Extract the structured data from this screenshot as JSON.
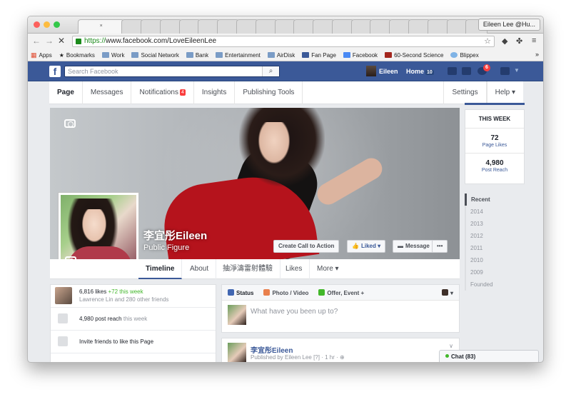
{
  "browser": {
    "active_tab": "×",
    "profile": "Eileen Lee @Hu...",
    "url_https": "https://",
    "url_rest": "www.facebook.com/LoveEileenLee",
    "bookmarks": [
      "Apps",
      "Bookmarks",
      "Work",
      "Social Network",
      "Bank",
      "Entertainment",
      "AirDisk",
      "Fan Page",
      "Facebook",
      "60-Second Science",
      "Blippex"
    ],
    "more": "»"
  },
  "fb": {
    "logo": "f",
    "search_placeholder": "Search Facebook",
    "user": "Eileen",
    "home": "Home",
    "home_count": "10",
    "notif_badge": "6"
  },
  "pagenav": {
    "items": [
      "Page",
      "Messages",
      "Notifications",
      "Insights",
      "Publishing Tools"
    ],
    "notif_count": "4",
    "settings": "Settings",
    "help": "Help ▾"
  },
  "profile": {
    "name": "李宜彤Eileen",
    "category": "Public Figure",
    "cta": "Create Call to Action",
    "liked": "Liked ▾",
    "message": "Message",
    "more": "•••"
  },
  "timeline_tabs": [
    "Timeline",
    "About",
    "抽淨濤雷射體驗",
    "Likes",
    "More ▾"
  ],
  "this_week": {
    "title": "THIS WEEK",
    "likes_num": "72",
    "likes_label": "Page Likes",
    "reach_num": "4,980",
    "reach_label": "Post Reach"
  },
  "years": [
    "Recent",
    "2014",
    "2013",
    "2012",
    "2011",
    "2010",
    "2009",
    "Founded"
  ],
  "left_card": {
    "likes": "6,816 likes",
    "likes_week": "+72 this week",
    "friends": "Lawrence Lin and 280 other friends",
    "reach": "4,980 post reach",
    "reach_week": "this week",
    "invite": "Invite friends to like this Page"
  },
  "composer": {
    "status": "Status",
    "photo": "Photo / Video",
    "offer": "Offer, Event +",
    "placeholder": "What have you been up to?"
  },
  "post": {
    "name": "李宜彤Eileen",
    "meta": "Published by Eileen Lee [?] · 1 hr · ⊕"
  },
  "chat": "Chat (83)",
  "colors": {
    "fb_blue": "#3b5998",
    "badge_red": "#fa3e3e",
    "green": "#42b72a"
  }
}
